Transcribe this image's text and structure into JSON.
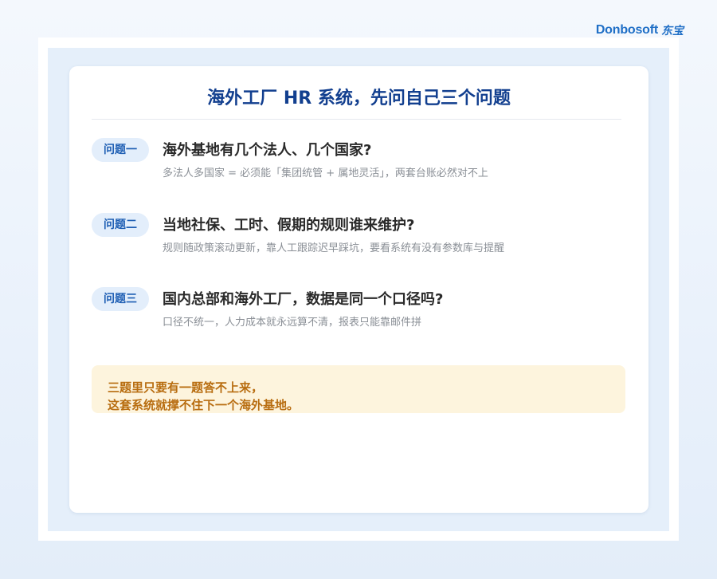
{
  "brand": {
    "name": "Donbosoft",
    "signature": "东宝"
  },
  "card": {
    "title": "海外工厂 HR 系统，先问自己三个问题",
    "questions": [
      {
        "badge": "问题一",
        "heading": "海外基地有几个法人、几个国家?",
        "detail": "多法人多国家 = 必须能「集团统管 + 属地灵活」，两套台账必然对不上"
      },
      {
        "badge": "问题二",
        "heading": "当地社保、工时、假期的规则谁来维护?",
        "detail": "规则随政策滚动更新，靠人工跟踪迟早踩坑，要看系统有没有参数库与提醒"
      },
      {
        "badge": "问题三",
        "heading": "国内总部和海外工厂，数据是同一个口径吗?",
        "detail": "口径不统一，人力成本就永远算不清，报表只能靠邮件拼"
      }
    ],
    "note": {
      "line1": "三题里只要有一题答不上来，",
      "line2": "这套系统就撑不住下一个海外基地。"
    }
  },
  "colors": {
    "title": "#123f8f",
    "badge_bg": "#e3eefb",
    "badge_text": "#1f5fb4",
    "note_bg": "#fdf4dd",
    "note_text": "#b86d10",
    "brand": "#1f6fc6"
  }
}
